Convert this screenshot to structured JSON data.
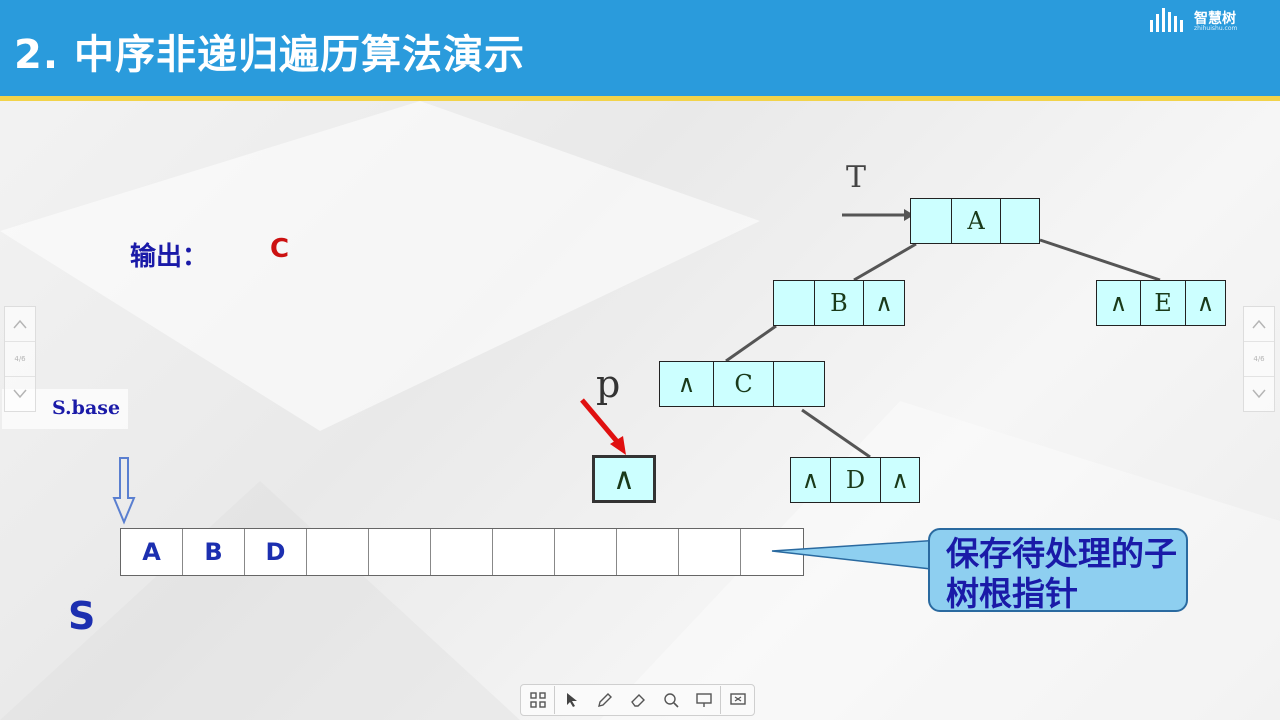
{
  "header": {
    "title": "2. 中序非递归遍历算法演示",
    "logo_text": "智慧树",
    "logo_sub": "zhihuishu.com"
  },
  "output": {
    "label": "输出：",
    "value": "C"
  },
  "stack": {
    "base_label": "S.base",
    "name": "S",
    "cells": [
      "A",
      "B",
      "D",
      "",
      "",
      "",
      "",
      "",
      "",
      "",
      ""
    ]
  },
  "tree": {
    "pointer_label": "T",
    "nodes": [
      {
        "id": "A",
        "left": "",
        "data": "A",
        "right": ""
      },
      {
        "id": "B",
        "left": "",
        "data": "B",
        "right": "∧"
      },
      {
        "id": "C",
        "left": "∧",
        "data": "C",
        "right": ""
      },
      {
        "id": "D",
        "left": "∧",
        "data": "D",
        "right": "∧"
      },
      {
        "id": "E",
        "left": "∧",
        "data": "E",
        "right": "∧"
      }
    ]
  },
  "p_pointer": {
    "label": "p",
    "value": "∧"
  },
  "callout": {
    "text": "保存待处理的子树根指针"
  },
  "side_nav": {
    "page": "4/6"
  },
  "toolbar": {
    "tools": [
      "grid-icon",
      "pointer-icon",
      "pen-icon",
      "eraser-icon",
      "search-icon",
      "screen-icon",
      "board-icon"
    ]
  },
  "colors": {
    "header": "#2a9bdc",
    "accent_line": "#f2d34a",
    "node_fill": "#ccffff",
    "text_blue": "#1a1aa8",
    "text_red": "#cc1111"
  }
}
